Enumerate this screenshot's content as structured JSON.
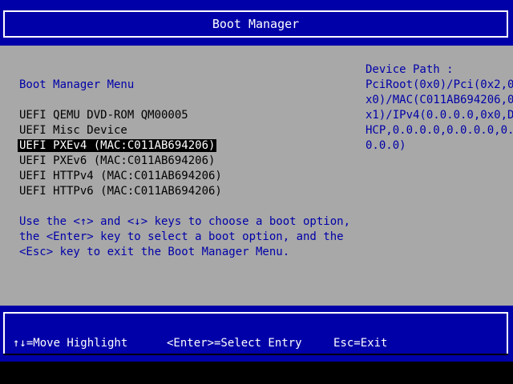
{
  "title": "Boot Manager",
  "menu_heading": "Boot Manager Menu",
  "boot_options": [
    {
      "label": "UEFI QEMU DVD-ROM QM00005",
      "selected": false
    },
    {
      "label": "UEFI Misc Device",
      "selected": false
    },
    {
      "label": "UEFI PXEv4 (MAC:C011AB694206)",
      "selected": true
    },
    {
      "label": "UEFI PXEv6 (MAC:C011AB694206)",
      "selected": false
    },
    {
      "label": "UEFI HTTPv4 (MAC:C011AB694206)",
      "selected": false
    },
    {
      "label": "UEFI HTTPv6 (MAC:C011AB694206)",
      "selected": false
    }
  ],
  "instructions": [
    "Use the <↑> and <↓> keys to choose a boot option,",
    "the <Enter> key to select a boot option, and the",
    "<Esc> key to exit the Boot Manager Menu."
  ],
  "device_path": {
    "heading": "Device Path :",
    "lines": [
      "PciRoot(0x0)/Pci(0x2,0",
      "x0)/MAC(C011AB694206,0",
      "x1)/IPv4(0.0.0.0,0x0,D",
      "HCP,0.0.0.0,0.0.0.0,0.",
      "0.0.0)"
    ]
  },
  "footer": {
    "move": "↑↓=Move Highlight",
    "select": "<Enter>=Select Entry",
    "exit": "Esc=Exit"
  },
  "colors": {
    "bar_background": "#0000a8",
    "body_background": "#a8a8a8",
    "accent_text": "#0000a8",
    "highlight_background": "#000000",
    "highlight_text": "#ffffff"
  }
}
